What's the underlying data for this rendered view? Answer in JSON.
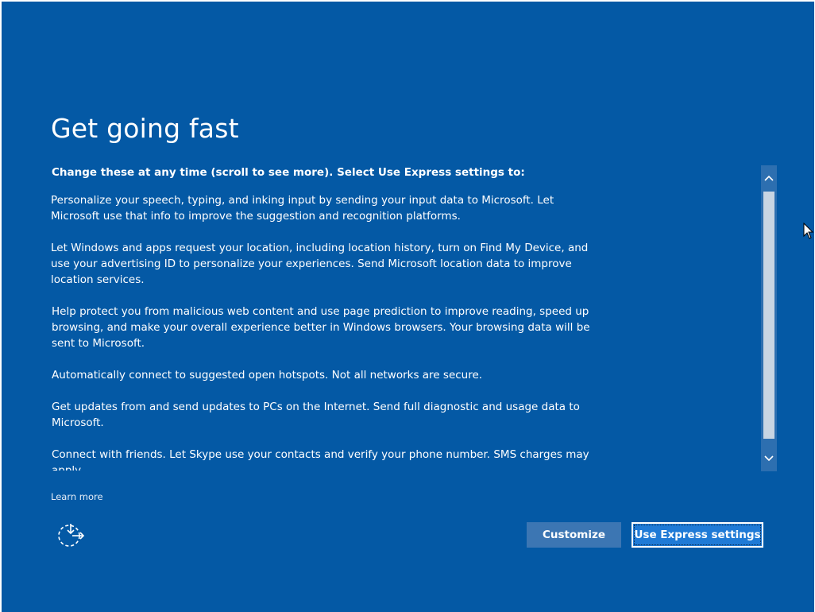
{
  "title": "Get going fast",
  "intro": "Change these at any time (scroll to see more). Select Use Express settings to:",
  "paragraphs": [
    "Personalize your speech, typing, and inking input by sending your input data to Microsoft. Let Microsoft use that info to improve the suggestion and recognition platforms.",
    "Let Windows and apps request your location, including location history, turn on Find My Device, and use your advertising ID to personalize your experiences. Send Microsoft location data to improve location services.",
    "Help protect you from malicious web content and use page prediction to improve reading, speed up browsing, and make your overall experience better in Windows browsers. Your browsing data will be sent to Microsoft.",
    "Automatically connect to suggested open hotspots. Not all networks are secure.",
    "Get updates from and send updates to PCs on the Internet. Send full diagnostic and usage data to Microsoft.",
    "Connect with friends. Let Skype use your contacts and verify your phone number. SMS charges may apply."
  ],
  "learn_more": "Learn more",
  "buttons": {
    "customize": "Customize",
    "express": "Use Express settings"
  },
  "icons": {
    "scroll_up": "chevron-up-icon",
    "scroll_down": "chevron-down-icon",
    "ease_of_access": "ease-of-access-icon",
    "cursor": "mouse-pointer-icon"
  },
  "colors": {
    "background": "#0459a5",
    "primary_button": "#1f7ad6",
    "secondary_button": "#3c76b3",
    "scrollbar_track": "#2d6fb0",
    "scrollbar_thumb": "#c8d5e3"
  }
}
